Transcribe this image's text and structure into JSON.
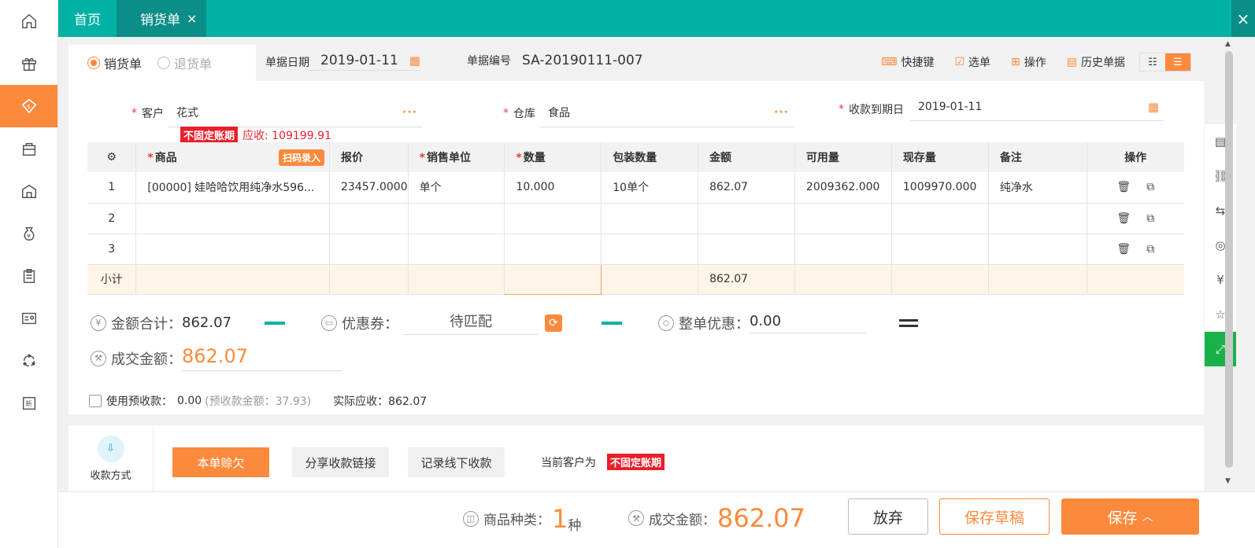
{
  "sidebar": {
    "items": [
      {
        "icon": "home-icon"
      },
      {
        "icon": "gift-icon"
      },
      {
        "icon": "sales-icon",
        "active": true
      },
      {
        "icon": "bag-icon"
      },
      {
        "icon": "warehouse-icon"
      },
      {
        "icon": "money-bag-icon"
      },
      {
        "icon": "clipboard-icon"
      },
      {
        "icon": "contacts-card-icon"
      },
      {
        "icon": "circle-nodes-icon"
      },
      {
        "icon": "new-icon"
      }
    ]
  },
  "tabs": {
    "home": "首页",
    "current": "销货单",
    "close_symbol": "×",
    "window_close": "×"
  },
  "doc": {
    "type_sales": "销货单",
    "type_return": "退货单",
    "date_label": "单据日期",
    "date_value": "2019-01-11",
    "number_label": "单据编号",
    "number_value": "SA-20190111-007"
  },
  "toolbar": {
    "shortcuts": "快捷键",
    "select": "选单",
    "operate": "操作",
    "history": "历史单据"
  },
  "form": {
    "customer_label": "客户",
    "customer_value": "花式",
    "warehouse_label": "仓库",
    "warehouse_value": "食品",
    "due_label": "收款到期日",
    "due_value": "2019-01-11",
    "dots": "···",
    "required": "*",
    "period_badge": "不固定账期",
    "receivable": "应收: 109199.91"
  },
  "table": {
    "headers": {
      "product": "商品",
      "scan": "扫码录入",
      "price": "报价",
      "unit": "销售单位",
      "qty": "数量",
      "pack_qty": "包装数量",
      "amount": "金额",
      "available": "可用量",
      "stock": "现存量",
      "remark": "备注",
      "ops": "操作"
    },
    "rows": [
      {
        "no": "1",
        "product": "[00000] 娃哈哈饮用纯净水596...",
        "price": "23457.0000",
        "unit": "单个",
        "qty": "10.000",
        "pack_qty": "10单个",
        "amount": "862.07",
        "available": "2009362.000",
        "stock": "1009970.000",
        "remark": "纯净水"
      },
      {
        "no": "2",
        "product": "",
        "price": "",
        "unit": "",
        "qty": "",
        "pack_qty": "",
        "amount": "",
        "available": "",
        "stock": "",
        "remark": ""
      },
      {
        "no": "3",
        "product": "",
        "price": "",
        "unit": "",
        "qty": "",
        "pack_qty": "",
        "amount": "",
        "available": "",
        "stock": "",
        "remark": ""
      }
    ],
    "subtotal_label": "小计",
    "subtotal_amount": "862.07"
  },
  "totals": {
    "sum_label": "金额合计：",
    "sum_value": "862.07",
    "coupon_label": "优惠券：",
    "coupon_value": "待匹配",
    "discount_label": "整单优惠：",
    "discount_value": "0.00",
    "deal_label": "成交金额：",
    "deal_value": "862.07"
  },
  "prepay": {
    "label": "使用预收款：",
    "value": "0.00",
    "balance": "(预收款金额：37.93)",
    "actual": "实际应收：862.07"
  },
  "payment": {
    "mode_label": "收款方式",
    "credit_btn": "本单赊欠",
    "share_btn": "分享收款链接",
    "offline_btn": "记录线下收款",
    "current_label": "当前客户为",
    "period_badge": "不固定账期"
  },
  "bottom": {
    "kinds_label": "商品种类：",
    "kinds_value": "1",
    "kinds_unit": "种",
    "deal_label": "成交金额：",
    "deal_value": "862.07",
    "abandon": "放弃",
    "save_draft": "保存草稿",
    "save": "保存"
  },
  "colors": {
    "accent": "#fb8a3c",
    "teal": "#01b2a4",
    "red": "#e8202c",
    "green": "#19b24a"
  }
}
